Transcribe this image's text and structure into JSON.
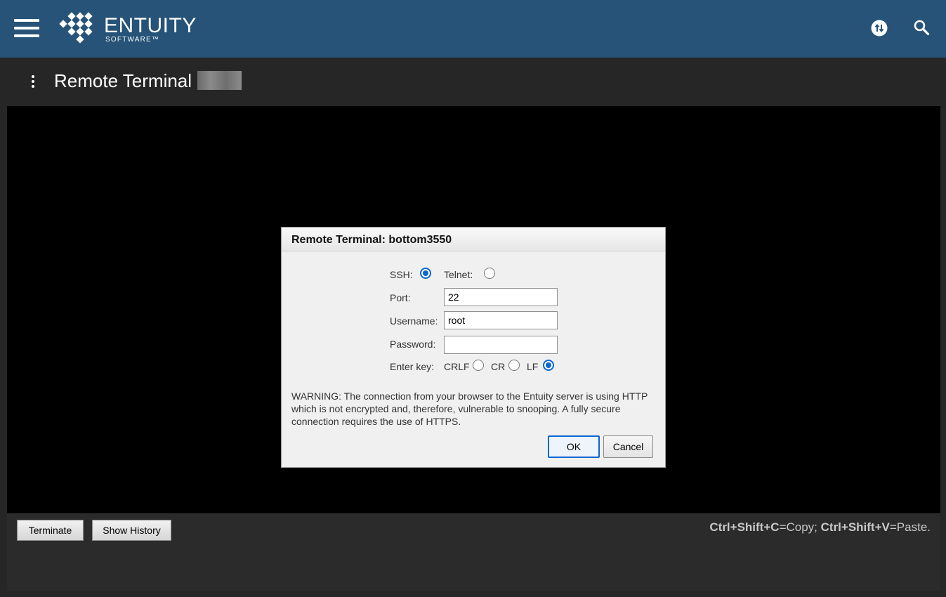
{
  "header": {
    "brand_name": "ENTUITY",
    "brand_sub": "SOFTWARE™"
  },
  "page": {
    "title": "Remote Terminal"
  },
  "dialog": {
    "title": "Remote Terminal: bottom3550",
    "protocol": {
      "ssh_label": "SSH:",
      "telnet_label": "Telnet:",
      "selected": "SSH"
    },
    "port": {
      "label": "Port:",
      "value": "22"
    },
    "username": {
      "label": "Username:",
      "value": "root"
    },
    "password": {
      "label": "Password:",
      "value": ""
    },
    "enter_key": {
      "label": "Enter key:",
      "options": [
        "CRLF",
        "CR",
        "LF"
      ],
      "selected": "LF"
    },
    "warning": "WARNING: The connection from your browser to the Entuity server is using HTTP which is not encrypted and, therefore, vulnerable to snooping. A fully secure connection requires the use of HTTPS.",
    "ok_label": "OK",
    "cancel_label": "Cancel"
  },
  "footer": {
    "terminate_label": "Terminate",
    "history_label": "Show History",
    "hint": {
      "copy_keys": "Ctrl+Shift+C",
      "copy_text": "=Copy; ",
      "paste_keys": "Ctrl+Shift+V",
      "paste_text": "=Paste."
    }
  },
  "colors": {
    "header_bg": "#265377",
    "page_bg": "#262626",
    "terminal_bg": "#000000",
    "radio_accent": "#0a66d1"
  },
  "icons": {
    "menu": "hamburger-menu-icon",
    "sync": "sync-icon",
    "search": "search-icon",
    "more": "more-vertical-icon"
  }
}
